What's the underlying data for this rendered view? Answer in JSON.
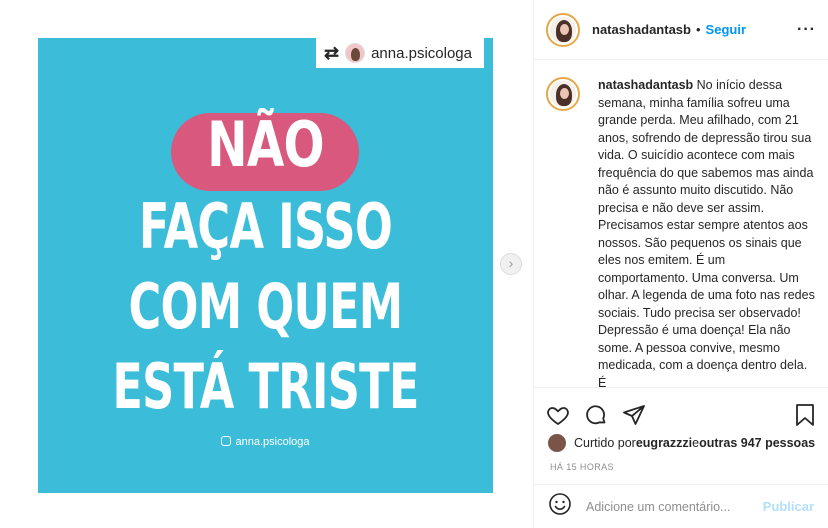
{
  "post": {
    "repost_username": "anna.psicologa",
    "image_lines": [
      "NÃO",
      "FAÇA ISSO",
      "COM QUEM",
      "ESTÁ TRISTE"
    ],
    "image_credit": "anna.psicologa",
    "image_bg_color": "#3bbcd8",
    "pill_color": "#d9587e"
  },
  "header": {
    "username": "natashadantasb",
    "separator": "•",
    "follow_label": "Seguir",
    "more_icon": "more-options-icon"
  },
  "caption": {
    "username": "natashadantasb",
    "text": " No início dessa semana, minha família sofreu uma grande perda. Meu afilhado, com 21 anos, sofrendo de depressão tirou sua vida. O suicídio acontece com mais frequência do que sabemos mas ainda não é assunto muito discutido. Não precisa e não deve ser assim. Precisamos estar sempre atentos aos nossos. São pequenos os sinais que eles nos emitem. É um comportamento. Uma conversa. Um olhar. A legenda de uma foto nas redes sociais. Tudo precisa ser observado! Depressão é uma doença! Ela não some. A pessoa convive, mesmo medicada, com a doença dentro dela. É"
  },
  "likes": {
    "prefix": "Curtido por ",
    "user": "eugrazzzi",
    "middle": " e ",
    "others": "outras 947 pessoas"
  },
  "timestamp": "HÁ 15 HORAS",
  "comment": {
    "placeholder": "Adicione um comentário...",
    "post_label": "Publicar"
  },
  "colors": {
    "link_blue": "#0095f6",
    "post_disabled": "#b2dffc"
  }
}
